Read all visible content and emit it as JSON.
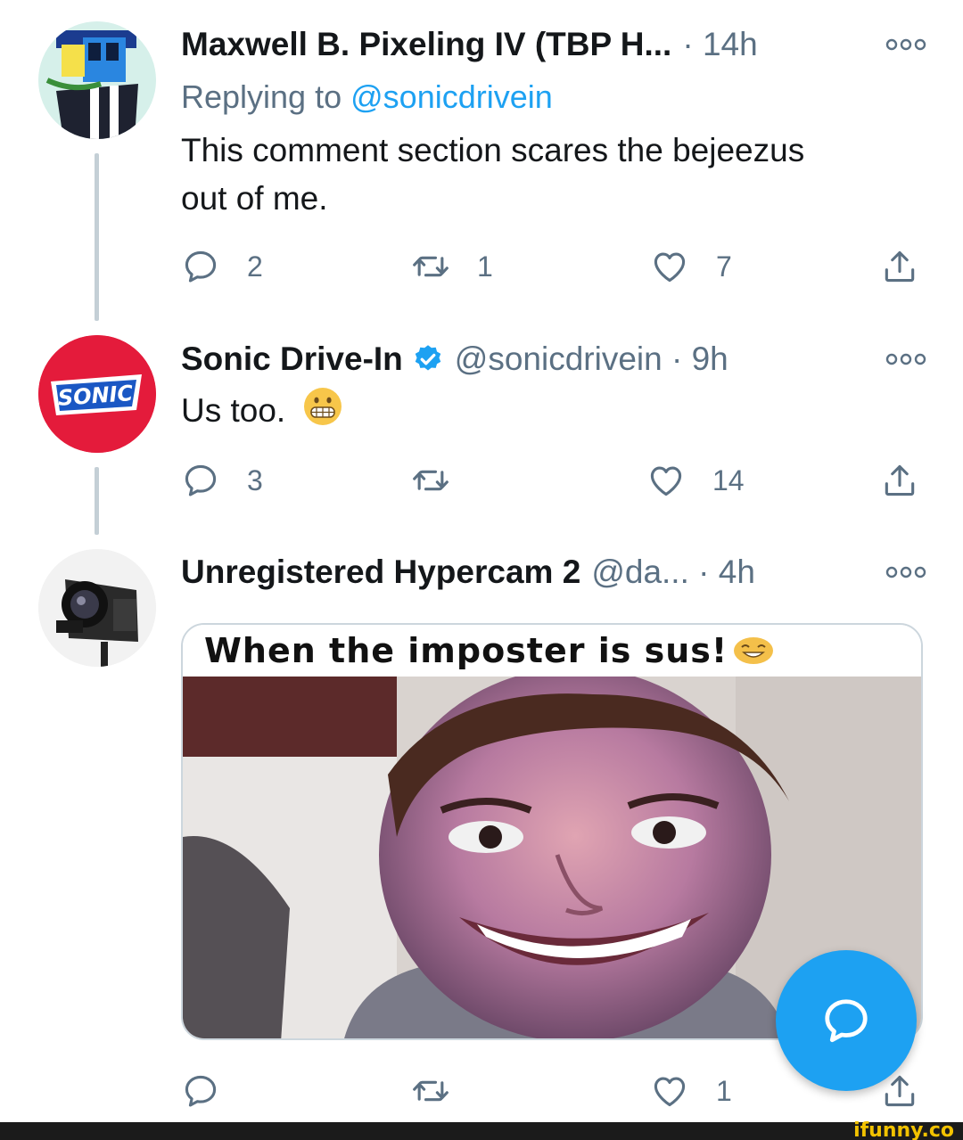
{
  "tweets": [
    {
      "name": "Maxwell B. Pixeling IV (TBP H...",
      "meta": "· 14h",
      "replying_prefix": "Replying to",
      "replying_handle": "@sonicdrivein",
      "text_line1": "This comment section scares the bejeezus",
      "text_line2": "out of me.",
      "replies": "2",
      "retweets": "1",
      "likes": "7"
    },
    {
      "name": "Sonic Drive-In",
      "meta": "@sonicdrivein · 9h",
      "text": "Us too.",
      "avatar_text": "SONIC",
      "replies": "3",
      "retweets": "",
      "likes": "14"
    },
    {
      "name": "Unregistered Hypercam 2",
      "meta": "@da... · 4h",
      "media_caption": "When the imposter is sus!",
      "replies": "",
      "retweets": "",
      "likes": "1"
    }
  ],
  "watermark": "ifunny.co",
  "colors": {
    "accent": "#1da1f2",
    "muted": "#5b7083",
    "sonic_red": "#e41b3b",
    "thread_line": "#c4cfd6"
  },
  "icons": [
    "reply-icon",
    "retweet-icon",
    "like-icon",
    "share-icon",
    "more-icon",
    "verified-badge-icon",
    "compose-icon",
    "grimacing-emoji"
  ]
}
